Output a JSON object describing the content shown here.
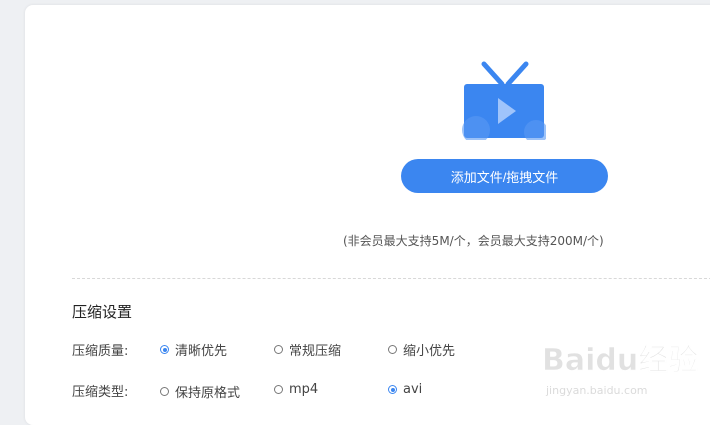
{
  "upload": {
    "button_label": "添加文件/拖拽文件",
    "limit_note": "(非会员最大支持5M/个，会员最大支持200M/个)"
  },
  "settings": {
    "title": "压缩设置",
    "quality": {
      "label": "压缩质量:",
      "options": [
        {
          "label": "清晰优先",
          "checked": true
        },
        {
          "label": "常规压缩",
          "checked": false
        },
        {
          "label": "缩小优先",
          "checked": false
        }
      ]
    },
    "type": {
      "label": "压缩类型:",
      "options": [
        {
          "label": "保持原格式",
          "checked": false
        },
        {
          "label": "mp4",
          "checked": false
        },
        {
          "label": "avi",
          "checked": true
        }
      ]
    }
  },
  "watermark": {
    "brand": "Baidu经验",
    "url": "jingyan.baidu.com"
  },
  "colors": {
    "accent": "#3b86f0",
    "page_bg": "#eef0f3"
  },
  "icons": {
    "upload_illustration": "tv-play-icon"
  }
}
